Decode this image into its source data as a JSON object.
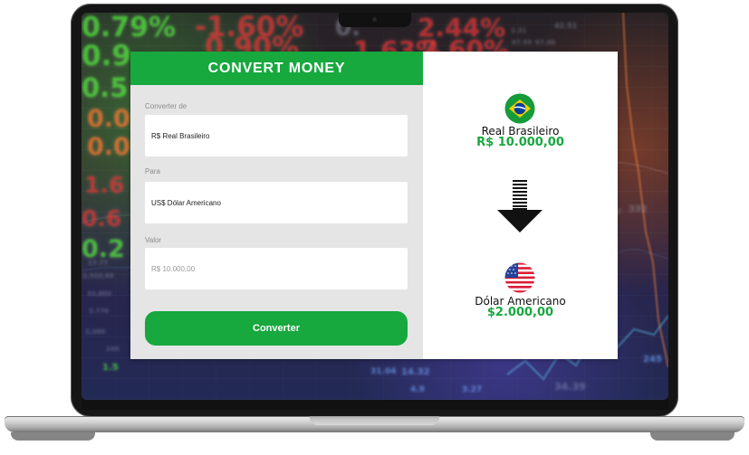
{
  "app": {
    "title": "CONVERT MONEY",
    "accent_color": "#17a83e",
    "panel_color": "#e5e5e5"
  },
  "form": {
    "from_label": "Converter de",
    "from_value": "R$ Real Brasileiro",
    "to_label": "Para",
    "to_value": "US$ Dólar Americano",
    "amount_label": "Valor",
    "amount_placeholder": "R$ 10.000,00",
    "button_label": "Converter"
  },
  "summary": {
    "source_currency_name": "Real Brasileiro",
    "source_amount": "R$ 10.000,00",
    "target_currency_name": "Dólar Americano",
    "target_amount": "$2.000,00"
  },
  "icons": {
    "source_flag": "brazil-flag-icon",
    "target_flag": "usa-flag-icon",
    "direction": "down-arrow-icon"
  },
  "background_tickers": [
    "0.79%",
    "-1.60%",
    "0.9",
    "0.90%",
    "0.5",
    "0.0",
    "0.0",
    "1.6",
    "0.6",
    "0.2",
    "0.",
    "2.44%",
    "1.63%",
    "2.60%",
    "332",
    "245",
    "34.39",
    "14.32",
    "2,322,44",
    "3.776",
    "2,389",
    "249",
    "17.77",
    "33,869",
    "31.04",
    "4.9",
    "3.27",
    "3,387",
    "2.31",
    "67.59",
    "67.46",
    "42.51",
    "1.5"
  ]
}
